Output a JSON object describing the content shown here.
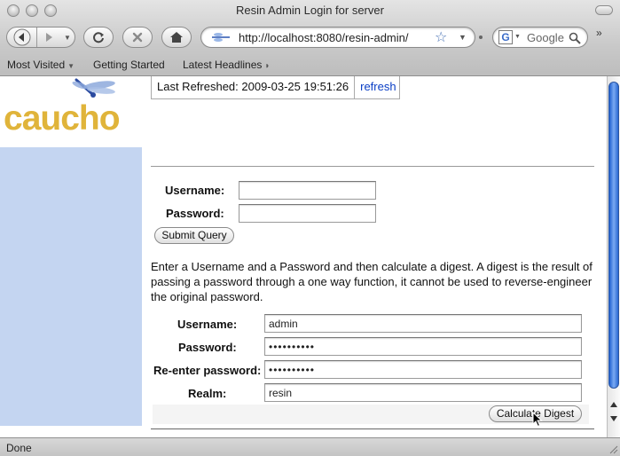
{
  "window": {
    "title": "Resin Admin Login for server"
  },
  "toolbar": {
    "url": "http://localhost:8080/resin-admin/",
    "search_placeholder": "Google"
  },
  "bookmarks": [
    {
      "label": "Most Visited"
    },
    {
      "label": "Getting Started"
    },
    {
      "label": "Latest Headlines"
    }
  ],
  "brand": {
    "logo_text": "caucho"
  },
  "refresh": {
    "label": "Last Refreshed: 2009-03-25 19:51:26",
    "link": "refresh"
  },
  "login": {
    "username_label": "Username:",
    "password_label": "Password:",
    "username_value": "",
    "password_value": "",
    "submit_label": "Submit Query"
  },
  "digest": {
    "description": "Enter a Username and a Password and then calculate a digest. A digest is the result of passing a password through a one way function, it cannot be used to reverse-engineer the original password.",
    "username_label": "Username:",
    "password_label": "Password:",
    "reenter_label": "Re-enter password:",
    "realm_label": "Realm:",
    "username_value": "admin",
    "password_value": "••••••••••",
    "reenter_value": "••••••••••",
    "realm_value": "resin",
    "button_label": "Calculate Digest"
  },
  "status": {
    "text": "Done"
  },
  "colors": {
    "sidebar": "#c4d5f1",
    "logo": "#e0b43a",
    "link": "#0a3ec5",
    "scrollbar": "#2a68d2"
  }
}
